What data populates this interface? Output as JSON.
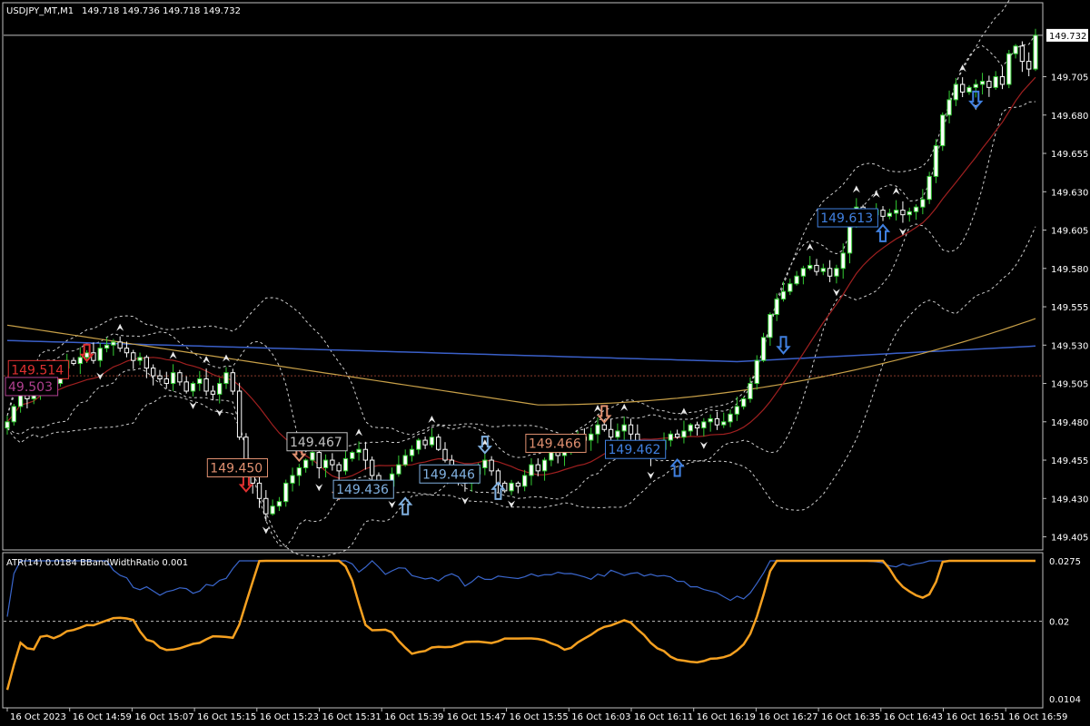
{
  "header": {
    "symbol_label": "USDJPY_MT,M1",
    "ohlc": "149.718 149.736 149.718 149.732"
  },
  "indicator_header": {
    "label": "ATR(14) 0.0184  BBandWidthRatio 0.001"
  },
  "colors": {
    "background": "#000000",
    "bull_candle": "#33cc33",
    "bull_body": "#ffffff",
    "bear_candle": "#ffffff",
    "ma_blue": "#3a5fc8",
    "ma_yellow": "#c8a048",
    "ma_red": "#a02020",
    "bands": "#cfcfcf",
    "atr_line": "#3a66cc",
    "bbwr_line": "#f5a020",
    "price_line": "#c0c0c0",
    "dotted_level": "#8a3a2a"
  },
  "price_axis": {
    "ticks": [
      "149.705",
      "149.680",
      "149.655",
      "149.630",
      "149.605",
      "149.580",
      "149.555",
      "149.530",
      "149.505",
      "149.480",
      "149.455",
      "149.430",
      "149.405"
    ],
    "current": "149.732"
  },
  "indicator_axis": {
    "ticks": [
      "0.0275",
      "0.02",
      "0.0104"
    ]
  },
  "time_axis": {
    "ticks": [
      "16 Oct 2023",
      "16 Oct 14:59",
      "16 Oct 15:07",
      "16 Oct 15:15",
      "16 Oct 15:23",
      "16 Oct 15:31",
      "16 Oct 15:39",
      "16 Oct 15:47",
      "16 Oct 15:55",
      "16 Oct 16:03",
      "16 Oct 16:11",
      "16 Oct 16:19",
      "16 Oct 16:27",
      "16 Oct 16:35",
      "16 Oct 16:43",
      "16 Oct 16:51",
      "16 Oct 16:59"
    ]
  },
  "price_labels": [
    {
      "text": "149.514",
      "color": "#e03030",
      "price": 149.514,
      "bar": 4
    },
    {
      "text": "49.503",
      "color": "#b04090",
      "price": 149.503,
      "bar": 2
    },
    {
      "text": "149.450",
      "color": "#e09070",
      "price": 149.45,
      "bar": 34
    },
    {
      "text": "149.467",
      "color": "#c0c0c0",
      "price": 149.467,
      "bar": 46
    },
    {
      "text": "149.436",
      "color": "#80b0e0",
      "price": 149.436,
      "bar": 53
    },
    {
      "text": "149.446",
      "color": "#80b0e0",
      "price": 149.446,
      "bar": 66
    },
    {
      "text": "149.466",
      "color": "#e09070",
      "price": 149.466,
      "bar": 82
    },
    {
      "text": "149.462",
      "color": "#4080e0",
      "price": 149.462,
      "bar": 94
    },
    {
      "text": "149.613",
      "color": "#4080e0",
      "price": 149.613,
      "bar": 126
    }
  ],
  "arrows": [
    {
      "dir": "down",
      "color": "#e03030",
      "bar": 12,
      "price": 149.525
    },
    {
      "dir": "down",
      "color": "#e03030",
      "bar": 36,
      "price": 149.44
    },
    {
      "dir": "down",
      "color": "#e09070",
      "bar": 44,
      "price": 149.46
    },
    {
      "dir": "down",
      "color": "#e09070",
      "bar": 50,
      "price": 149.435
    },
    {
      "dir": "up",
      "color": "#80b0e0",
      "bar": 60,
      "price": 149.425
    },
    {
      "dir": "up",
      "color": "#80b0e0",
      "bar": 74,
      "price": 149.435
    },
    {
      "dir": "down",
      "color": "#80b0e0",
      "bar": 72,
      "price": 149.465
    },
    {
      "dir": "down",
      "color": "#e09070",
      "bar": 90,
      "price": 149.485
    },
    {
      "dir": "up",
      "color": "#4080e0",
      "bar": 101,
      "price": 149.45
    },
    {
      "dir": "down",
      "color": "#4080e0",
      "bar": 117,
      "price": 149.53
    },
    {
      "dir": "up",
      "color": "#4080e0",
      "bar": 132,
      "price": 149.603
    },
    {
      "dir": "down",
      "color": "#4080e0",
      "bar": 146,
      "price": 149.69
    }
  ],
  "chart_data": {
    "type": "candlestick",
    "title": "USDJPY_MT,M1",
    "price_range": [
      149.4,
      149.742
    ],
    "level_line": 149.51,
    "current_price": 149.732,
    "closes": [
      149.48,
      149.49,
      149.503,
      149.495,
      149.5,
      149.514,
      149.51,
      149.505,
      149.515,
      149.52,
      149.518,
      149.522,
      149.525,
      149.52,
      149.528,
      149.53,
      149.532,
      149.528,
      149.525,
      149.52,
      149.522,
      149.515,
      149.51,
      149.508,
      149.505,
      149.512,
      149.506,
      149.5,
      149.505,
      149.508,
      149.5,
      149.498,
      149.505,
      149.512,
      149.5,
      149.47,
      149.45,
      149.44,
      149.43,
      149.42,
      149.425,
      149.428,
      149.44,
      149.445,
      149.45,
      149.455,
      149.46,
      149.45,
      149.455,
      149.452,
      149.448,
      149.456,
      149.46,
      149.462,
      149.455,
      149.445,
      149.44,
      149.438,
      149.446,
      149.452,
      149.458,
      149.462,
      149.468,
      149.465,
      149.47,
      149.462,
      149.455,
      149.448,
      149.442,
      149.44,
      149.446,
      149.45,
      149.455,
      149.448,
      149.44,
      149.435,
      149.44,
      149.438,
      149.445,
      149.452,
      149.448,
      149.455,
      149.46,
      149.458,
      149.462,
      149.466,
      149.47,
      149.468,
      149.472,
      149.478,
      149.475,
      149.47,
      149.474,
      149.478,
      149.472,
      149.466,
      149.462,
      149.458,
      149.462,
      149.468,
      149.472,
      149.47,
      149.474,
      149.478,
      149.476,
      149.48,
      149.482,
      149.478,
      149.48,
      149.485,
      149.49,
      149.495,
      149.505,
      149.52,
      149.535,
      149.55,
      149.56,
      149.565,
      149.57,
      149.575,
      149.58,
      149.582,
      149.578,
      149.58,
      149.575,
      149.58,
      149.59,
      149.61,
      149.62,
      149.613,
      149.615,
      149.618,
      149.614,
      149.616,
      149.618,
      149.615,
      149.617,
      149.62,
      149.625,
      149.64,
      149.66,
      149.68,
      149.69,
      149.7,
      149.695,
      149.698,
      149.7,
      149.702,
      149.698,
      149.705,
      149.7,
      149.72,
      149.725,
      149.715,
      149.71,
      149.732
    ],
    "atr_series": {
      "name": "ATR(14)",
      "current": 0.0184
    },
    "bbwr_series": {
      "name": "BBandWidthRatio",
      "current": 0.001
    },
    "indicator_range": [
      0.0104,
      0.0275
    ]
  }
}
